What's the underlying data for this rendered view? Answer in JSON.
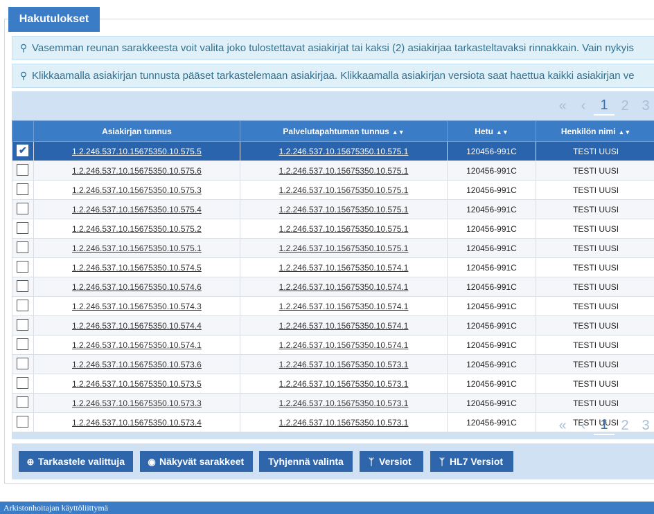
{
  "panel": {
    "title": "Hakutulokset"
  },
  "info": {
    "line1": "Vasemman reunan sarakkeesta voit valita joko tulostettavat asiakirjat tai kaksi (2) asiakirjaa tarkasteltavaksi rinnakkain. Vain nykyis",
    "line2": "Klikkaamalla asiakirjan tunnusta pääset tarkastelemaan asiakirjaa. Klikkaamalla asiakirjan versiota saat haettua kaikki asiakirjan ve",
    "icon": "lightbulb-icon"
  },
  "pager": {
    "first": "«",
    "prev": "‹",
    "pages": [
      "1",
      "2",
      "3"
    ],
    "current": "1"
  },
  "table": {
    "columns": [
      "Asiakirjan tunnus",
      "Palvelutapahtuman tunnus",
      "Hetu",
      "Henkilön nimi"
    ],
    "rows": [
      {
        "selected": true,
        "doc": "1.2.246.537.10.15675350.10.575.5",
        "event": "1.2.246.537.10.15675350.10.575.1",
        "hetu": "120456-991C",
        "name": "TESTI UUSI"
      },
      {
        "selected": false,
        "doc": "1.2.246.537.10.15675350.10.575.6",
        "event": "1.2.246.537.10.15675350.10.575.1",
        "hetu": "120456-991C",
        "name": "TESTI UUSI"
      },
      {
        "selected": false,
        "doc": "1.2.246.537.10.15675350.10.575.3",
        "event": "1.2.246.537.10.15675350.10.575.1",
        "hetu": "120456-991C",
        "name": "TESTI UUSI"
      },
      {
        "selected": false,
        "doc": "1.2.246.537.10.15675350.10.575.4",
        "event": "1.2.246.537.10.15675350.10.575.1",
        "hetu": "120456-991C",
        "name": "TESTI UUSI"
      },
      {
        "selected": false,
        "doc": "1.2.246.537.10.15675350.10.575.2",
        "event": "1.2.246.537.10.15675350.10.575.1",
        "hetu": "120456-991C",
        "name": "TESTI UUSI"
      },
      {
        "selected": false,
        "doc": "1.2.246.537.10.15675350.10.575.1",
        "event": "1.2.246.537.10.15675350.10.575.1",
        "hetu": "120456-991C",
        "name": "TESTI UUSI"
      },
      {
        "selected": false,
        "doc": "1.2.246.537.10.15675350.10.574.5",
        "event": "1.2.246.537.10.15675350.10.574.1",
        "hetu": "120456-991C",
        "name": "TESTI UUSI"
      },
      {
        "selected": false,
        "doc": "1.2.246.537.10.15675350.10.574.6",
        "event": "1.2.246.537.10.15675350.10.574.1",
        "hetu": "120456-991C",
        "name": "TESTI UUSI"
      },
      {
        "selected": false,
        "doc": "1.2.246.537.10.15675350.10.574.3",
        "event": "1.2.246.537.10.15675350.10.574.1",
        "hetu": "120456-991C",
        "name": "TESTI UUSI"
      },
      {
        "selected": false,
        "doc": "1.2.246.537.10.15675350.10.574.4",
        "event": "1.2.246.537.10.15675350.10.574.1",
        "hetu": "120456-991C",
        "name": "TESTI UUSI"
      },
      {
        "selected": false,
        "doc": "1.2.246.537.10.15675350.10.574.1",
        "event": "1.2.246.537.10.15675350.10.574.1",
        "hetu": "120456-991C",
        "name": "TESTI UUSI"
      },
      {
        "selected": false,
        "doc": "1.2.246.537.10.15675350.10.573.6",
        "event": "1.2.246.537.10.15675350.10.573.1",
        "hetu": "120456-991C",
        "name": "TESTI UUSI"
      },
      {
        "selected": false,
        "doc": "1.2.246.537.10.15675350.10.573.5",
        "event": "1.2.246.537.10.15675350.10.573.1",
        "hetu": "120456-991C",
        "name": "TESTI UUSI"
      },
      {
        "selected": false,
        "doc": "1.2.246.537.10.15675350.10.573.3",
        "event": "1.2.246.537.10.15675350.10.573.1",
        "hetu": "120456-991C",
        "name": "TESTI UUSI"
      },
      {
        "selected": false,
        "doc": "1.2.246.537.10.15675350.10.573.4",
        "event": "1.2.246.537.10.15675350.10.573.1",
        "hetu": "120456-991C",
        "name": "TESTI UUSI"
      }
    ]
  },
  "toolbar": {
    "view_selected": "Tarkastele valittuja",
    "visible_columns": "Näkyvät sarakkeet",
    "clear_selection": "Tyhjennä valinta",
    "versions": "Versiot",
    "hl7_versions": "HL7 Versiot"
  },
  "footer": {
    "text": "Arkistonhoitajan käyttöliittymä"
  },
  "colors": {
    "accent": "#3a7cc6",
    "selected_row": "#2a64ad",
    "info_bg": "#dff0f9",
    "grid_bg": "#cfe1f3"
  }
}
